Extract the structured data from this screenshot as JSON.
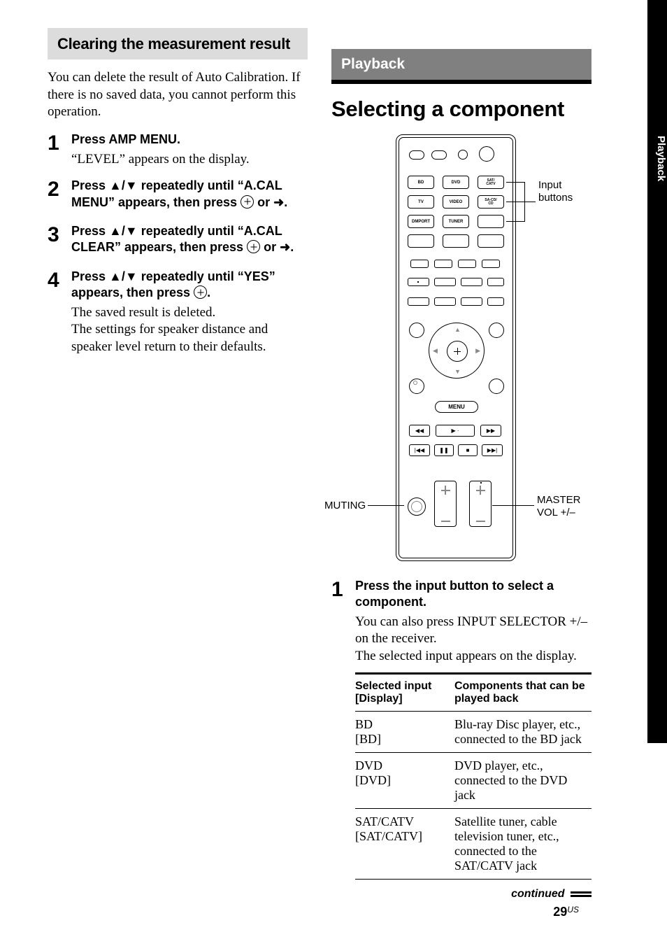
{
  "side_tab": "Playback",
  "left": {
    "subheading": "Clearing the measurement result",
    "intro": "You can delete the result of Auto Calibration. If there is no saved data, you cannot perform this operation.",
    "steps": [
      {
        "n": "1",
        "bold": "Press AMP MENU.",
        "note": "“LEVEL” appears on the display."
      },
      {
        "n": "2",
        "bold_a": "Press ",
        "bold_b": " repeatedly until “A.CAL MENU” appears, then press ",
        "bold_c": " or ",
        "bold_d": "."
      },
      {
        "n": "3",
        "bold_a": "Press ",
        "bold_b": " repeatedly until “A.CAL CLEAR” appears, then press ",
        "bold_c": " or ",
        "bold_d": "."
      },
      {
        "n": "4",
        "bold_a": "Press ",
        "bold_b": " repeatedly until “YES” appears, then press ",
        "bold_c": ".",
        "note": "The saved result is deleted.\nThe settings for speaker distance and speaker level return to their defaults."
      }
    ]
  },
  "right": {
    "section_label": "Playback",
    "title": "Selecting a component",
    "remote": {
      "input_buttons": [
        "BD",
        "DVD",
        "SAT/\nCATV",
        "TV",
        "VIDEO",
        "SA-CD/\nCD",
        "DMPORT",
        "TUNER"
      ],
      "menu_label": "MENU",
      "callouts": {
        "input": "Input buttons",
        "muting": "MUTING",
        "master": "MASTER VOL +/–"
      }
    },
    "step1": {
      "n": "1",
      "bold": "Press the input button to select a component.",
      "note": "You can also press INPUT SELECTOR +/– on the receiver.\nThe selected input appears on the display."
    },
    "table": {
      "h1": "Selected input [Display]",
      "h2": "Components that can be played back",
      "rows": [
        {
          "a": "BD\n[BD]",
          "b": "Blu-ray Disc player, etc., connected to the BD jack"
        },
        {
          "a": "DVD\n[DVD]",
          "b": "DVD player, etc., connected to the DVD jack"
        },
        {
          "a": "SAT/CATV\n[SAT/CATV]",
          "b": "Satellite tuner, cable television tuner, etc., connected to the SAT/CATV jack"
        }
      ]
    },
    "continued": "continued"
  },
  "page_number": "29",
  "page_suffix": "US"
}
